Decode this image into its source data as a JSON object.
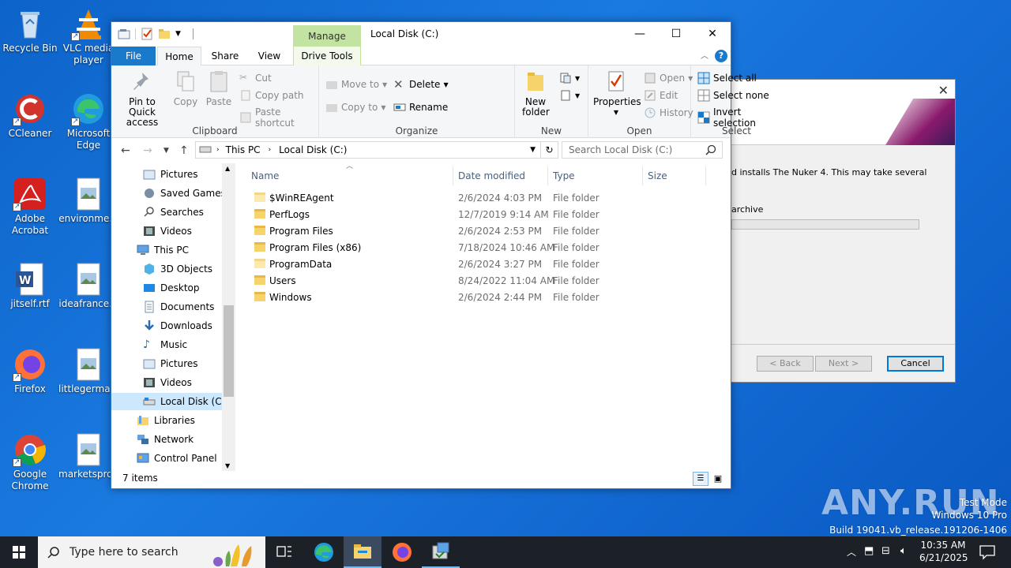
{
  "desktop": {
    "icons": [
      {
        "label": "Recycle Bin",
        "icon": "recycle-bin-icon"
      },
      {
        "label": "VLC media player",
        "icon": "vlc-icon"
      },
      {
        "label": "CCleaner",
        "icon": "ccleaner-icon"
      },
      {
        "label": "Microsoft Edge",
        "icon": "edge-icon"
      },
      {
        "label": "Adobe Acrobat",
        "icon": "acrobat-icon"
      },
      {
        "label": "environme...",
        "icon": "image-file-icon"
      },
      {
        "label": "jitself.rtf",
        "icon": "word-file-icon"
      },
      {
        "label": "ideafrance...",
        "icon": "image-file-icon"
      },
      {
        "label": "Firefox",
        "icon": "firefox-icon"
      },
      {
        "label": "littlegerma...",
        "icon": "image-file-icon"
      },
      {
        "label": "Google Chrome",
        "icon": "chrome-icon"
      },
      {
        "label": "marketspro...",
        "icon": "image-file-icon"
      }
    ]
  },
  "installer": {
    "message": "d installs The Nuker 4.  This may take several",
    "status": "archive",
    "back_label": "< Back",
    "next_label": "Next >",
    "cancel_label": "Cancel"
  },
  "explorer": {
    "title": "Local Disk (C:)",
    "contextual_tab": "Manage",
    "tabs": {
      "file": "File",
      "home": "Home",
      "share": "Share",
      "view": "View",
      "drive_tools": "Drive Tools"
    },
    "ribbon": {
      "clipboard": {
        "label": "Clipboard",
        "pin": "Pin to Quick access",
        "copy": "Copy",
        "paste": "Paste",
        "cut": "Cut",
        "copy_path": "Copy path",
        "paste_shortcut": "Paste shortcut"
      },
      "organize": {
        "label": "Organize",
        "move_to": "Move to",
        "copy_to": "Copy to",
        "delete": "Delete",
        "rename": "Rename"
      },
      "new": {
        "label": "New",
        "new_folder": "New folder"
      },
      "open": {
        "label": "Open",
        "properties": "Properties",
        "open": "Open",
        "edit": "Edit",
        "history": "History"
      },
      "select": {
        "label": "Select",
        "select_all": "Select all",
        "select_none": "Select none",
        "invert": "Invert selection"
      }
    },
    "address": {
      "crumbs": [
        "This PC",
        "Local Disk (C:)"
      ],
      "search_placeholder": "Search Local Disk (C:)"
    },
    "nav": [
      {
        "label": "Pictures",
        "icon": "pictures-icon",
        "indent": 1
      },
      {
        "label": "Saved Games",
        "icon": "saved-games-icon",
        "indent": 1
      },
      {
        "label": "Searches",
        "icon": "searches-icon",
        "indent": 1
      },
      {
        "label": "Videos",
        "icon": "videos-icon",
        "indent": 1
      },
      {
        "label": "This PC",
        "icon": "this-pc-icon",
        "indent": 0
      },
      {
        "label": "3D Objects",
        "icon": "3d-objects-icon",
        "indent": 1
      },
      {
        "label": "Desktop",
        "icon": "desktop-icon",
        "indent": 1
      },
      {
        "label": "Documents",
        "icon": "documents-icon",
        "indent": 1
      },
      {
        "label": "Downloads",
        "icon": "downloads-icon",
        "indent": 1
      },
      {
        "label": "Music",
        "icon": "music-icon",
        "indent": 1
      },
      {
        "label": "Pictures",
        "icon": "pictures-icon",
        "indent": 1
      },
      {
        "label": "Videos",
        "icon": "videos-icon",
        "indent": 1
      },
      {
        "label": "Local Disk (C:)",
        "icon": "drive-icon",
        "indent": 1,
        "selected": true
      },
      {
        "label": "Libraries",
        "icon": "libraries-icon",
        "indent": 0
      },
      {
        "label": "Network",
        "icon": "network-icon",
        "indent": 0
      },
      {
        "label": "Control Panel",
        "icon": "control-panel-icon",
        "indent": 0
      }
    ],
    "columns": {
      "name": "Name",
      "date": "Date modified",
      "type": "Type",
      "size": "Size"
    },
    "files": [
      {
        "name": "$WinREAgent",
        "date": "2/6/2024 4:03 PM",
        "type": "File folder",
        "hidden": true
      },
      {
        "name": "PerfLogs",
        "date": "12/7/2019 9:14 AM",
        "type": "File folder"
      },
      {
        "name": "Program Files",
        "date": "2/6/2024 2:53 PM",
        "type": "File folder"
      },
      {
        "name": "Program Files (x86)",
        "date": "7/18/2024 10:46 AM",
        "type": "File folder"
      },
      {
        "name": "ProgramData",
        "date": "2/6/2024 3:27 PM",
        "type": "File folder",
        "hidden": true
      },
      {
        "name": "Users",
        "date": "8/24/2022 11:04 AM",
        "type": "File folder"
      },
      {
        "name": "Windows",
        "date": "2/6/2024 2:44 PM",
        "type": "File folder"
      }
    ],
    "status": "7 items"
  },
  "taskbar": {
    "search_placeholder": "Type here to search",
    "time": "10:35 AM",
    "date": "6/21/2025"
  },
  "watermark": {
    "brand": "ANY.RUN",
    "line1": "Test Mode",
    "line2": "Windows 10 Pro",
    "line3": "Build 19041.vb_release.191206-1406"
  },
  "colors": {
    "accent": "#1979ca",
    "manage": "#c3e3a2",
    "selection": "#cce8ff",
    "taskbar": "#1c2027"
  }
}
